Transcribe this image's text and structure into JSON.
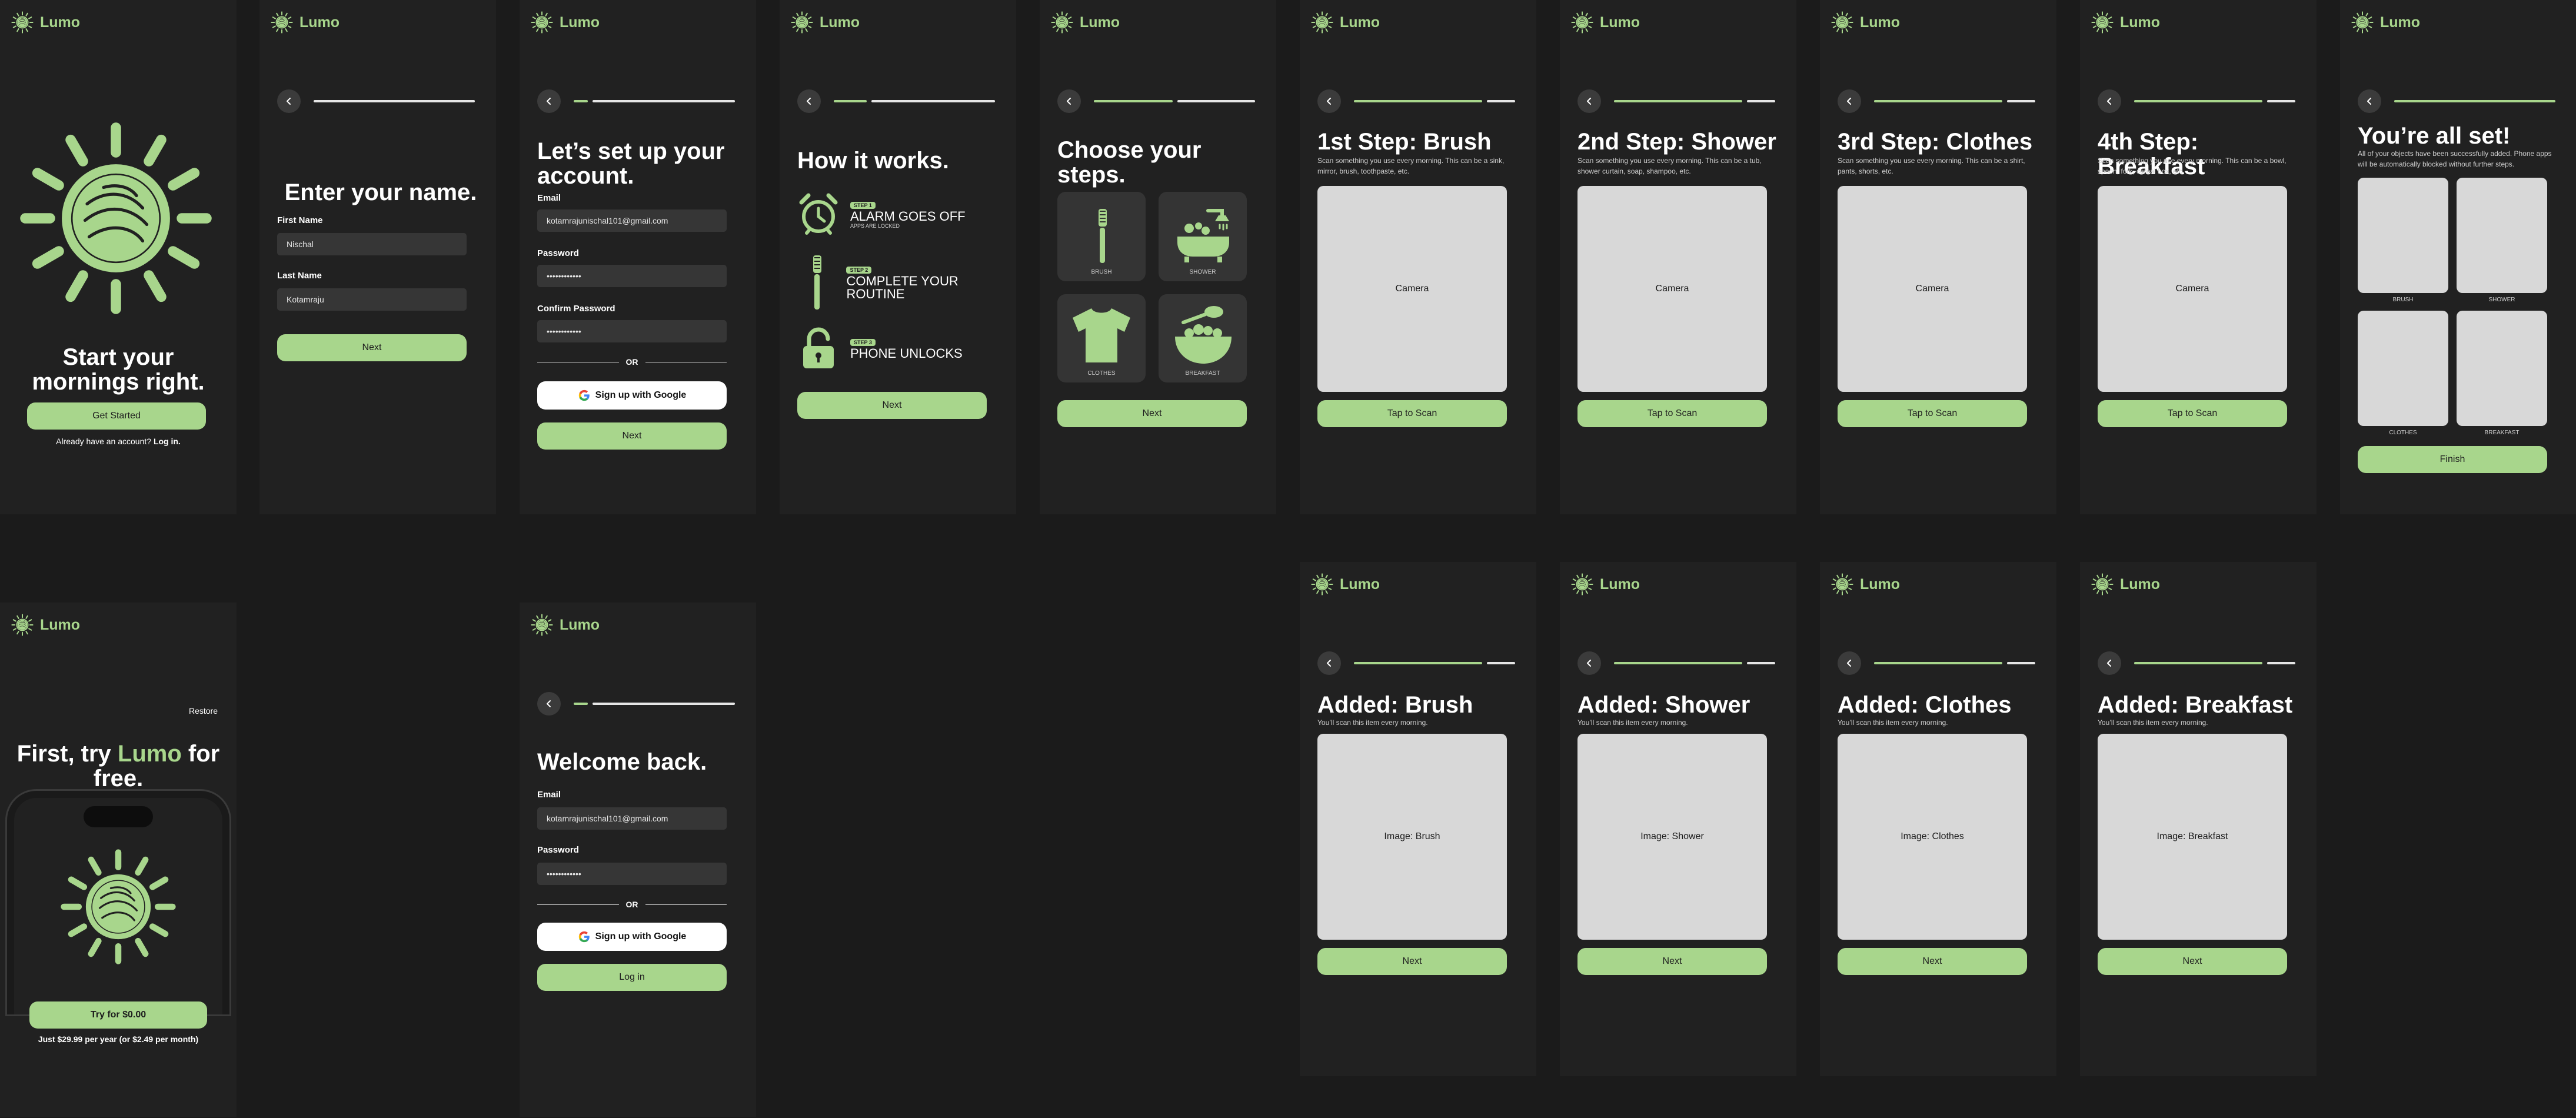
{
  "brand": {
    "name": "Lumo"
  },
  "colors": {
    "accent": "#a8d68c",
    "background": "#212121",
    "input": "#363636",
    "placeholder_box": "#d8d8d8"
  },
  "welcome": {
    "headline": "Start your mornings right.",
    "cta": "Get Started",
    "login_prefix": "Already have an account?",
    "login_link": "Log in."
  },
  "name_screen": {
    "title": "Enter your name.",
    "first_label": "First Name",
    "first_value": "Nischal",
    "last_label": "Last Name",
    "last_value": "Kotamraju",
    "next": "Next"
  },
  "signup": {
    "title": "Let’s set up your account.",
    "email_label": "Email",
    "email_value": "kotamrajunischal101@gmail.com",
    "password_label": "Password",
    "password_value": "••••••••••••",
    "confirm_label": "Confirm Password",
    "confirm_value": "••••••••••••",
    "or": "OR",
    "google": "Sign up with Google",
    "next": "Next"
  },
  "how": {
    "title": "How it works.",
    "steps": [
      {
        "badge": "STEP 1",
        "title": "ALARM GOES OFF",
        "sub": "APPS ARE LOCKED",
        "icon": "alarm-clock-icon"
      },
      {
        "badge": "STEP 2",
        "title": "COMPLETE YOUR ROUTINE",
        "sub": "",
        "icon": "toothbrush-icon"
      },
      {
        "badge": "STEP 3",
        "title": "PHONE UNLOCKS",
        "sub": "",
        "icon": "unlock-icon"
      }
    ],
    "next": "Next"
  },
  "choose": {
    "title": "Choose your steps.",
    "items": [
      "BRUSH",
      "SHOWER",
      "CLOTHES",
      "BREAKFAST"
    ],
    "next": "Next"
  },
  "scan": [
    {
      "title": "1st Step: Brush",
      "desc": "Scan something you use every morning. This can be a sink, mirror, brush, toothpaste, etc.",
      "camera": "Camera",
      "button": "Tap to Scan"
    },
    {
      "title": "2nd Step: Shower",
      "desc": "Scan something you use every morning. This can be a tub, shower curtain, soap, shampoo, etc.",
      "camera": "Camera",
      "button": "Tap to Scan"
    },
    {
      "title": "3rd Step: Clothes",
      "desc": "Scan something you use every morning. This can be a shirt, pants, shorts, etc.",
      "camera": "Camera",
      "button": "Tap to Scan"
    },
    {
      "title": "4th Step: Breakfast",
      "desc": "Scan something you use every morning. This can be a bowl, spoon, fork, cereal box, etc.",
      "camera": "Camera",
      "button": "Tap to Scan"
    }
  ],
  "added": [
    {
      "title": "Added: Brush",
      "desc": "You’ll scan this item every morning.",
      "image": "Image: Brush",
      "button": "Next"
    },
    {
      "title": "Added: Shower",
      "desc": "You’ll scan this item every morning.",
      "image": "Image: Shower",
      "button": "Next"
    },
    {
      "title": "Added: Clothes",
      "desc": "You’ll scan this item every morning.",
      "image": "Image: Clothes",
      "button": "Next"
    },
    {
      "title": "Added: Breakfast",
      "desc": "You’ll scan this item every morning.",
      "image": "Image: Breakfast",
      "button": "Next"
    }
  ],
  "done": {
    "title": "You’re all set!",
    "desc": "All of your objects have been successfully added. Phone apps will be automatically blocked without further steps.",
    "captions": [
      "BRUSH",
      "SHOWER",
      "CLOTHES",
      "BREAKFAST"
    ],
    "finish": "Finish"
  },
  "paywall": {
    "restore": "Restore",
    "headline_pre": "First, try ",
    "headline_brand": "Lumo",
    "headline_post": " for free.",
    "cta": "Try for $0.00",
    "price": "Just $29.99 per year (or $2.49 per month)"
  },
  "login": {
    "title": "Welcome back.",
    "email_label": "Email",
    "email_value": "kotamrajunischal101@gmail.com",
    "password_label": "Password",
    "password_value": "••••••••••••",
    "or": "OR",
    "google": "Sign up with Google",
    "cta": "Log in"
  }
}
